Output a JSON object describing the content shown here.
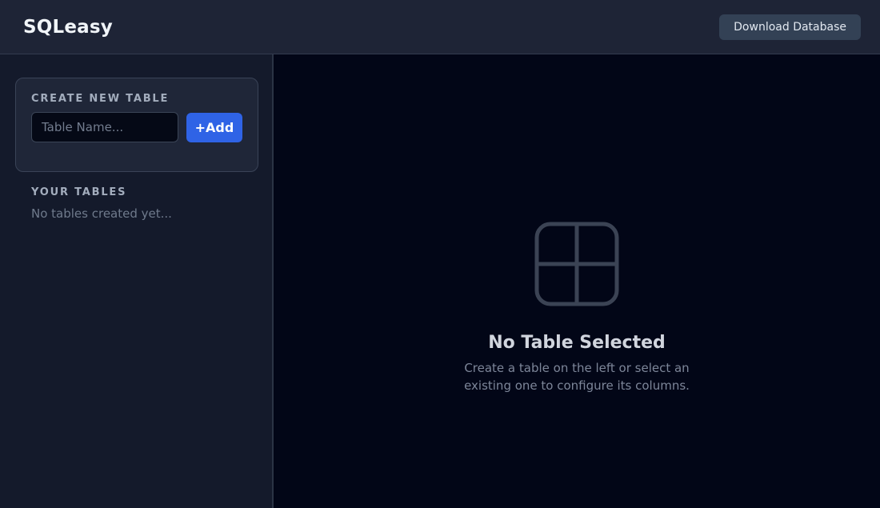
{
  "app": {
    "title": "SQLeasy"
  },
  "header": {
    "download_label": "Download Database"
  },
  "sidebar": {
    "create": {
      "heading": "CREATE NEW TABLE",
      "input_placeholder": "Table Name...",
      "input_value": "",
      "add_label": "+Add"
    },
    "tables": {
      "heading": "YOUR TABLES",
      "empty_text": "No tables created yet...",
      "items": []
    }
  },
  "main": {
    "empty_icon": "table-grid-icon",
    "empty_title": "No Table Selected",
    "empty_description": "Create a table on the left or select an existing one to configure its columns."
  },
  "colors": {
    "accent": "#2f63e6",
    "header_bg": "#1e2436",
    "sidebar_bg": "#141a2b",
    "main_bg": "#020617"
  }
}
